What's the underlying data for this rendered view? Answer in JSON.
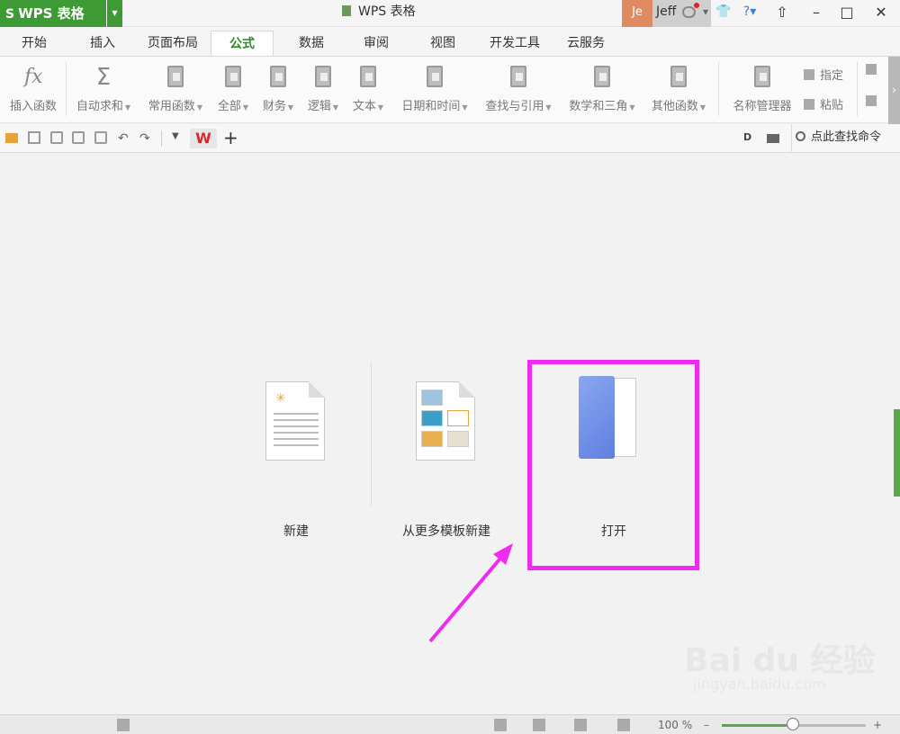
{
  "app": {
    "menu_label": "WPS 表格",
    "window_title": "WPS 表格"
  },
  "user": {
    "avatar": "Je",
    "name": "Jeff"
  },
  "tabs": [
    "开始",
    "插入",
    "页面布局",
    "公式",
    "数据",
    "审阅",
    "视图",
    "开发工具",
    "云服务"
  ],
  "active_tab": "公式",
  "ribbon": {
    "insert_function": "插入函数",
    "autosum": "自动求和",
    "common": "常用函数",
    "all": "全部",
    "finance": "财务",
    "logic": "逻辑",
    "text": "文本",
    "datetime": "日期和时间",
    "lookup": "查找与引用",
    "math": "数学和三角",
    "other": "其他函数",
    "name_manager": "名称管理器",
    "assign": "指定",
    "paste": "粘贴"
  },
  "quickbar": {
    "search_command": "点此查找命令"
  },
  "start": {
    "new": "新建",
    "from_template": "从更多模板新建",
    "open": "打开"
  },
  "status": {
    "zoom": "100 %"
  },
  "watermark": {
    "line1": "Bai du 经验",
    "line2": "jingyan.baidu.com"
  },
  "colors": {
    "accent_green": "#3d9a35",
    "highlight": "#f02bf0"
  },
  "icons": [
    "fx-icon",
    "sigma-icon",
    "book-icon",
    "folder-open-icon",
    "save-icon",
    "undo-icon",
    "redo-icon",
    "search-icon",
    "document-icon",
    "template-icon",
    "folder-icon"
  ]
}
